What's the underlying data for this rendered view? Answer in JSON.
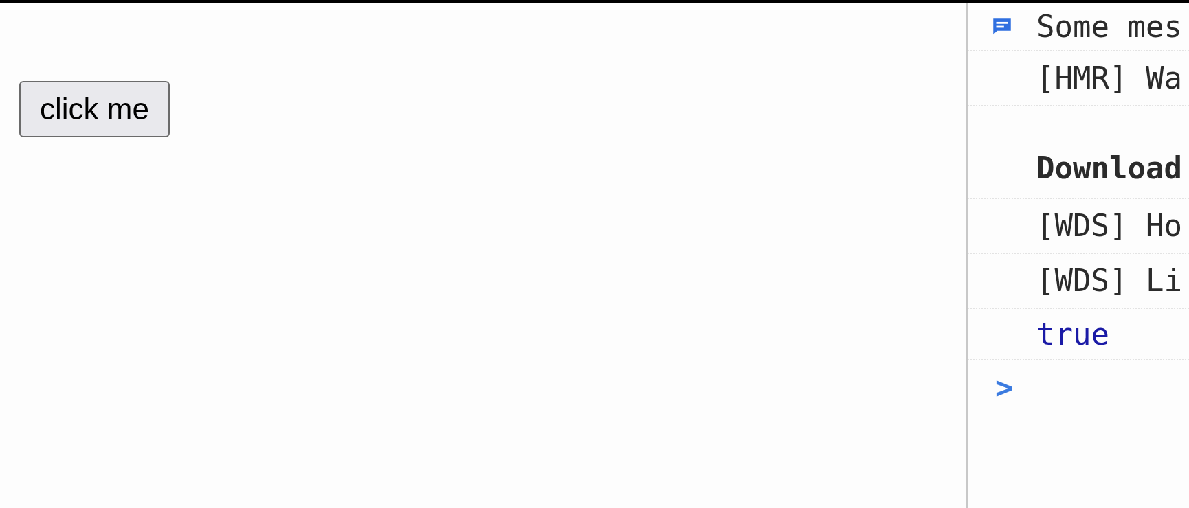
{
  "page": {
    "button": "click me"
  },
  "console": {
    "messages": [
      {
        "kind": "info",
        "text": "Some mes"
      },
      {
        "kind": "log",
        "text": "[HMR] Wa"
      },
      {
        "kind": "spaced-bold",
        "text": "Download"
      },
      {
        "kind": "log",
        "text": "[WDS] Ho"
      },
      {
        "kind": "log",
        "text": "[WDS] Li"
      },
      {
        "kind": "result",
        "text": "true"
      }
    ],
    "prompt": ">"
  }
}
